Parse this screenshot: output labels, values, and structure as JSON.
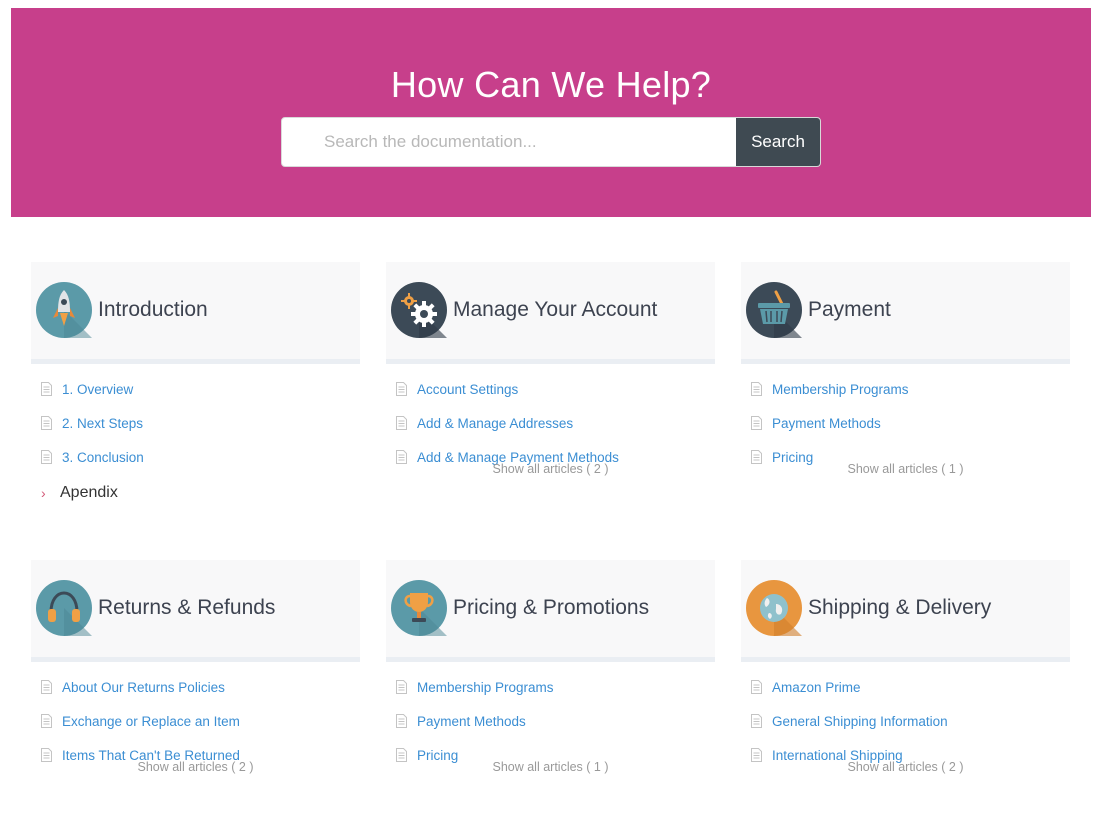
{
  "hero": {
    "title": "How Can We Help?",
    "search_placeholder": "Search the documentation...",
    "search_button": "Search",
    "background": "#c73f8b"
  },
  "sections": [
    {
      "title": "Introduction",
      "icon": "rocket-icon",
      "articles": [
        "1. Overview",
        "2. Next Steps",
        "3. Conclusion"
      ],
      "subsection": "Apendix",
      "show_all": ""
    },
    {
      "title": "Manage Your Account",
      "icon": "gear-icon",
      "articles": [
        "Account Settings",
        "Add & Manage Addresses",
        "Add & Manage Payment Methods"
      ],
      "show_all": "Show all articles ( 2 )"
    },
    {
      "title": "Payment",
      "icon": "basket-icon",
      "articles": [
        "Membership Programs",
        "Payment Methods",
        "Pricing"
      ],
      "show_all": "Show all articles ( 1 )"
    },
    {
      "title": "Returns & Refunds",
      "icon": "headphones-icon",
      "articles": [
        "About Our Returns Policies",
        "Exchange or Replace an Item",
        "Items That Can't Be Returned"
      ],
      "show_all": "Show all articles ( 2 )"
    },
    {
      "title": "Pricing & Promotions",
      "icon": "trophy-icon",
      "articles": [
        "Membership Programs",
        "Payment Methods",
        "Pricing"
      ],
      "show_all": "Show all articles ( 1 )"
    },
    {
      "title": "Shipping & Delivery",
      "icon": "globe-icon",
      "articles": [
        "Amazon Prime",
        "General Shipping Information",
        "International Shipping"
      ],
      "show_all": "Show all articles ( 2 )"
    }
  ],
  "colors": {
    "link": "#3b8ed3",
    "muted": "#999999",
    "heading": "#3d4350"
  }
}
